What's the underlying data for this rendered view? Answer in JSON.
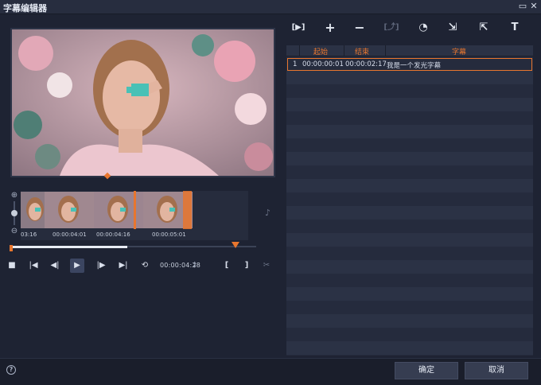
{
  "window": {
    "title": "字幕编辑器",
    "restore_glyph": "▭",
    "close_glyph": "✕"
  },
  "player": {
    "thumbnails": [
      {
        "time": "03:16"
      },
      {
        "time": "00:00:04:01"
      },
      {
        "time": "00:00:04:16"
      },
      {
        "time": "00:00:05:01"
      }
    ],
    "timecode": "00:00:04:28",
    "controls": [
      {
        "name": "stop-button",
        "glyph": "■"
      },
      {
        "name": "go-to-start-button",
        "glyph": "|◀"
      },
      {
        "name": "previous-frame-button",
        "glyph": "◀|"
      },
      {
        "name": "play-button",
        "glyph": "▶"
      },
      {
        "name": "next-frame-button",
        "glyph": "|▶"
      },
      {
        "name": "go-to-end-button",
        "glyph": "▶|"
      },
      {
        "name": "repeat-button",
        "glyph": "⟲"
      }
    ],
    "mark_in_glyph": "[",
    "mark_out_glyph": "]",
    "split_glyph": "✂",
    "zoom_in_glyph": "⊕",
    "zoom_out_glyph": "⊖",
    "audio_glyph": "♪",
    "progress_fraction": 0.47
  },
  "toolbar": {
    "buttons": [
      {
        "name": "play-subtitle-button",
        "glyph": "[▶]"
      },
      {
        "name": "add-subtitle-button",
        "glyph": "+"
      },
      {
        "name": "remove-subtitle-button",
        "glyph": "−"
      },
      {
        "name": "merge-subtitle-button",
        "glyph": "[⤴]",
        "enabled": false
      },
      {
        "name": "time-shift-button",
        "glyph": "◔"
      },
      {
        "name": "import-subtitle-button",
        "glyph": "⇲"
      },
      {
        "name": "export-subtitle-button",
        "glyph": "⇱"
      },
      {
        "name": "text-options-button",
        "glyph": "T"
      }
    ]
  },
  "subtitle_list": {
    "columns": {
      "start": "起始",
      "end": "结束",
      "text": "字幕"
    },
    "rows": [
      {
        "index": "1",
        "start": "00:00:00:01",
        "end": "00:00:02:17",
        "text": "我是一个发光字幕"
      }
    ]
  },
  "footer": {
    "help_glyph": "?",
    "ok_label": "确定",
    "cancel_label": "取消"
  },
  "colors": {
    "accent": "#e8762e",
    "background": "#1e2333",
    "grid_stripe_a": "#252b3d",
    "grid_stripe_b": "#2b3245"
  }
}
